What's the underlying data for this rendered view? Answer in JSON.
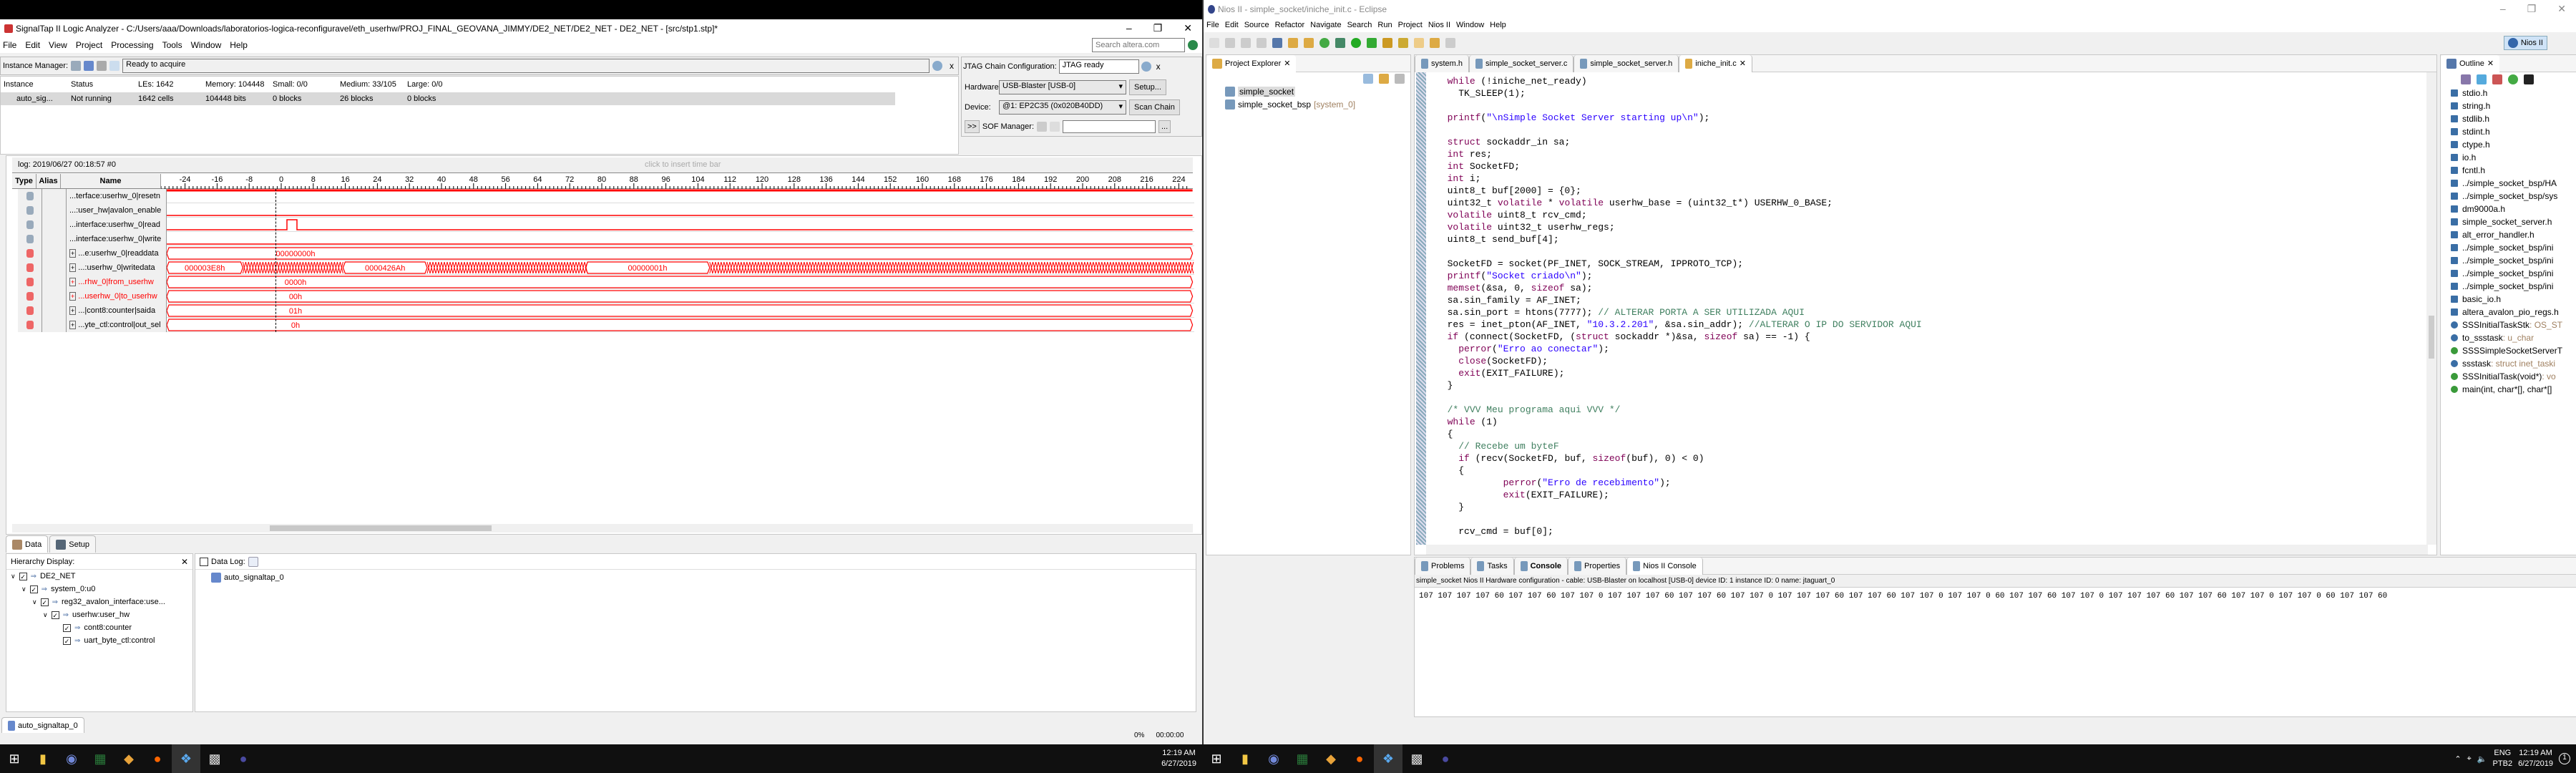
{
  "signaltap": {
    "title": "SignalTap II Logic Analyzer - C:/Users/aaa/Downloads/laboratorios-logica-reconfiguravel/eth_userhw/PROJ_FINAL_GEOVANA_JIMMY/DE2_NET/DE2_NET - DE2_NET - [src/stp1.stp]*",
    "menu": [
      "File",
      "Edit",
      "View",
      "Project",
      "Processing",
      "Tools",
      "Window",
      "Help"
    ],
    "search_placeholder": "Search altera.com",
    "instance_manager": {
      "label": "Instance Manager:",
      "status": "Ready to acquire"
    },
    "instance_table": {
      "headers": [
        "Instance",
        "Status",
        "LEs: 1642",
        "Memory: 104448",
        "Small: 0/0",
        "Medium: 33/105",
        "Large: 0/0"
      ],
      "rows": [
        [
          "auto_sig...",
          "Not running",
          "1642 cells",
          "104448 bits",
          "0 blocks",
          "26 blocks",
          "0 blocks"
        ]
      ]
    },
    "jtag": {
      "label": "JTAG Chain Configuration:",
      "status": "JTAG ready",
      "hardware_label": "Hardware:",
      "hardware_value": "USB-Blaster [USB-0]",
      "setup_button": "Setup...",
      "device_label": "Device:",
      "device_value": "@1: EP2C35 (0x020B40DD)",
      "scan_button": "Scan Chain",
      "expand_button": ">>",
      "sof_label": "SOF Manager:",
      "browse_button": "..."
    },
    "waveform": {
      "log_label": "log: 2019/06/27 00:18:57  #0",
      "insert_hint": "click to insert time bar",
      "columns": [
        "Type",
        "Alias",
        "Name"
      ],
      "ticks": [
        -24,
        -16,
        -8,
        0,
        8,
        16,
        24,
        32,
        40,
        48,
        56,
        64,
        72,
        80,
        88,
        96,
        104,
        112,
        120,
        128,
        136,
        144,
        152,
        160,
        168,
        176,
        184,
        192,
        200,
        208,
        216,
        224
      ],
      "range": [
        -30,
        226
      ],
      "trigger_time": 0,
      "signals": [
        {
          "name": "...terface:userhw_0|resetn",
          "kind": "bit",
          "level": 1,
          "red_name": false
        },
        {
          "name": "...:user_hw|avalon_enable",
          "kind": "bit",
          "level": 0,
          "red_name": false
        },
        {
          "name": "...interface:userhw_0|read",
          "kind": "bit",
          "level": 0,
          "pulse": [
            0,
            2.5
          ],
          "red_name": false
        },
        {
          "name": "...interface:userhw_0|write",
          "kind": "bit",
          "level": 0,
          "red_name": false
        },
        {
          "name": "...e:userhw_0|readdata",
          "kind": "bus",
          "red_name": false,
          "segments": [
            {
              "from": -30,
              "to": 226,
              "label": "00000000h"
            }
          ]
        },
        {
          "name": "...:userhw_0|writedata",
          "kind": "bus",
          "red_name": false,
          "segments": [
            {
              "from": -30,
              "to": -11,
              "label": "000003E8h"
            },
            {
              "from": 14,
              "to": 35,
              "label": "0000426Ah"
            },
            {
              "from": 74.5,
              "to": 105.5,
              "label": "00000001h"
            }
          ],
          "toggles": [
            [
              -11,
              14
            ],
            [
              35,
              74.5
            ],
            [
              105.5,
              226
            ]
          ]
        },
        {
          "name": "...rhw_0|from_userhw",
          "kind": "bus",
          "red_name": true,
          "segments": [
            {
              "from": -30,
              "to": 226,
              "label": "0000h"
            }
          ]
        },
        {
          "name": "...userhw_0|to_userhw",
          "kind": "bus",
          "red_name": true,
          "segments": [
            {
              "from": -30,
              "to": 226,
              "label": "00h"
            }
          ]
        },
        {
          "name": "...|cont8:counter|saida",
          "kind": "bus",
          "red_name": false,
          "segments": [
            {
              "from": -30,
              "to": 226,
              "label": "01h"
            }
          ]
        },
        {
          "name": "...yte_ctl:control|out_sel",
          "kind": "bus",
          "red_name": false,
          "segments": [
            {
              "from": -30,
              "to": 226,
              "label": "0h"
            }
          ]
        }
      ]
    },
    "bottom_tabs": [
      "Data",
      "Setup"
    ],
    "hierarchy": {
      "title": "Hierarchy Display:",
      "items": [
        {
          "label": "DE2_NET",
          "depth": 0
        },
        {
          "label": "system_0:u0",
          "depth": 1
        },
        {
          "label": "reg32_avalon_interface:use...",
          "depth": 2
        },
        {
          "label": "userhw:user_hw",
          "depth": 3
        },
        {
          "label": "cont8:counter",
          "depth": 4
        },
        {
          "label": "uart_byte_ctl:control",
          "depth": 4
        }
      ]
    },
    "data_log": {
      "label": "Data Log:",
      "items": [
        "auto_signaltap_0"
      ]
    },
    "file_tab": "auto_signaltap_0",
    "status": {
      "progress": "0%",
      "time": "00:00:00"
    }
  },
  "eclipse": {
    "title": "Nios II - simple_socket/iniche_init.c - Eclipse",
    "menu": [
      "File",
      "Edit",
      "Source",
      "Refactor",
      "Navigate",
      "Search",
      "Run",
      "Project",
      "Nios II",
      "Window",
      "Help"
    ],
    "perspective": "Nios II",
    "project_explorer": {
      "title": "Project Explorer",
      "items": [
        {
          "label": "simple_socket",
          "suffix": ""
        },
        {
          "label": "simple_socket_bsp",
          "suffix": "[system_0]"
        }
      ]
    },
    "editor_tabs": [
      "system.h",
      "simple_socket_server.c",
      "simple_socket_server.h",
      "iniche_init.c"
    ],
    "active_tab": 3,
    "code": [
      "  while (!iniche_net_ready)",
      "    TK_SLEEP(1);",
      "",
      "  printf(\"\\nSimple Socket Server starting up\\n\");",
      "",
      "  struct sockaddr_in sa;",
      "  int res;",
      "  int SocketFD;",
      "  int i;",
      "  uint8_t buf[2000] = {0};",
      "  uint32_t volatile * volatile userhw_base = (uint32_t*) USERHW_0_BASE;",
      "  volatile uint8_t rcv_cmd;",
      "  volatile uint32_t userhw_regs;",
      "  uint8_t send_buf[4];",
      "",
      "  SocketFD = socket(PF_INET, SOCK_STREAM, IPPROTO_TCP);",
      "  printf(\"Socket criado\\n\");",
      "  memset(&sa, 0, sizeof sa);",
      "  sa.sin_family = AF_INET;",
      "  sa.sin_port = htons(7777); // ALTERAR PORTA A SER UTILIZADA AQUI",
      "  res = inet_pton(AF_INET, \"10.3.2.201\", &sa.sin_addr); //ALTERAR O IP DO SERVIDOR AQUI",
      "  if (connect(SocketFD, (struct sockaddr *)&sa, sizeof sa) == -1) {",
      "    perror(\"Erro ao conectar\");",
      "    close(SocketFD);",
      "    exit(EXIT_FAILURE);",
      "  }",
      "",
      "  /* VVV Meu programa aqui VVV */",
      "  while (1)",
      "  {",
      "    // Recebe um byteF",
      "    if (recv(SocketFD, buf, sizeof(buf), 0) < 0)",
      "    {",
      "            perror(\"Erro de recebimento\");",
      "            exit(EXIT_FAILURE);",
      "    }",
      "",
      "    rcv_cmd = buf[0];"
    ],
    "warning_lines": [
      20,
      31
    ],
    "outline": {
      "title": "Outline",
      "items": [
        {
          "label": "stdio.h",
          "type": "include"
        },
        {
          "label": "string.h",
          "type": "include"
        },
        {
          "label": "stdlib.h",
          "type": "include"
        },
        {
          "label": "stdint.h",
          "type": "include"
        },
        {
          "label": "ctype.h",
          "type": "include"
        },
        {
          "label": "io.h",
          "type": "include"
        },
        {
          "label": "fcntl.h",
          "type": "include"
        },
        {
          "label": "../simple_socket_bsp/HA",
          "type": "include"
        },
        {
          "label": "../simple_socket_bsp/sys",
          "type": "include"
        },
        {
          "label": "dm9000a.h",
          "type": "include"
        },
        {
          "label": "simple_socket_server.h",
          "type": "include"
        },
        {
          "label": "alt_error_handler.h",
          "type": "include"
        },
        {
          "label": "../simple_socket_bsp/ini",
          "type": "include"
        },
        {
          "label": "../simple_socket_bsp/ini",
          "type": "include"
        },
        {
          "label": "../simple_socket_bsp/ini",
          "type": "include"
        },
        {
          "label": "../simple_socket_bsp/ini",
          "type": "include"
        },
        {
          "label": "basic_io.h",
          "type": "include"
        },
        {
          "label": "altera_avalon_pio_regs.h",
          "type": "include"
        },
        {
          "label": "SSSInitialTaskStk",
          "detail": " : OS_ST",
          "type": "var"
        },
        {
          "label": "to_ssstask",
          "detail": " : u_char",
          "type": "var"
        },
        {
          "label": "SSSSimpleSocketServerT",
          "type": "decl"
        },
        {
          "label": "ssstask",
          "detail": " : struct inet_taski",
          "type": "var"
        },
        {
          "label": "SSSInitialTask(void*)",
          "detail": " : vo",
          "type": "func-warn"
        },
        {
          "label": "main(int, char*[], char*[]",
          "type": "func"
        }
      ]
    },
    "console": {
      "tabs": [
        "Problems",
        "Tasks",
        "Console",
        "Properties",
        "Nios II Console"
      ],
      "active_tab": 4,
      "description": "simple_socket Nios II Hardware configuration - cable: USB-Blaster on localhost [USB-0] device ID: 1 instance ID: 0 name: jtaguart_0",
      "output": "107 107 107 107 60 107 107 60 107 107 0 107 107 107 60 107 107 60 107 107 0 107 107 107 60 107 107 60 107 107 0 107 107 0 60 107 107 60 107 107 0 107 107 107 60 107 107 60 107 107 0 107 107 0 60 107 107 60"
    }
  },
  "taskbar_left": {
    "time": "12:19 AM",
    "date": "6/27/2019"
  },
  "taskbar_right": {
    "lang": "ENG",
    "layout": "PTB2",
    "time": "12:19 AM",
    "date": "6/27/2019",
    "notifications": "1"
  },
  "colors": {
    "wave": "#ff0000",
    "keyword": "#7f0055",
    "string": "#2a00ff",
    "comment": "#3f7f5f"
  }
}
